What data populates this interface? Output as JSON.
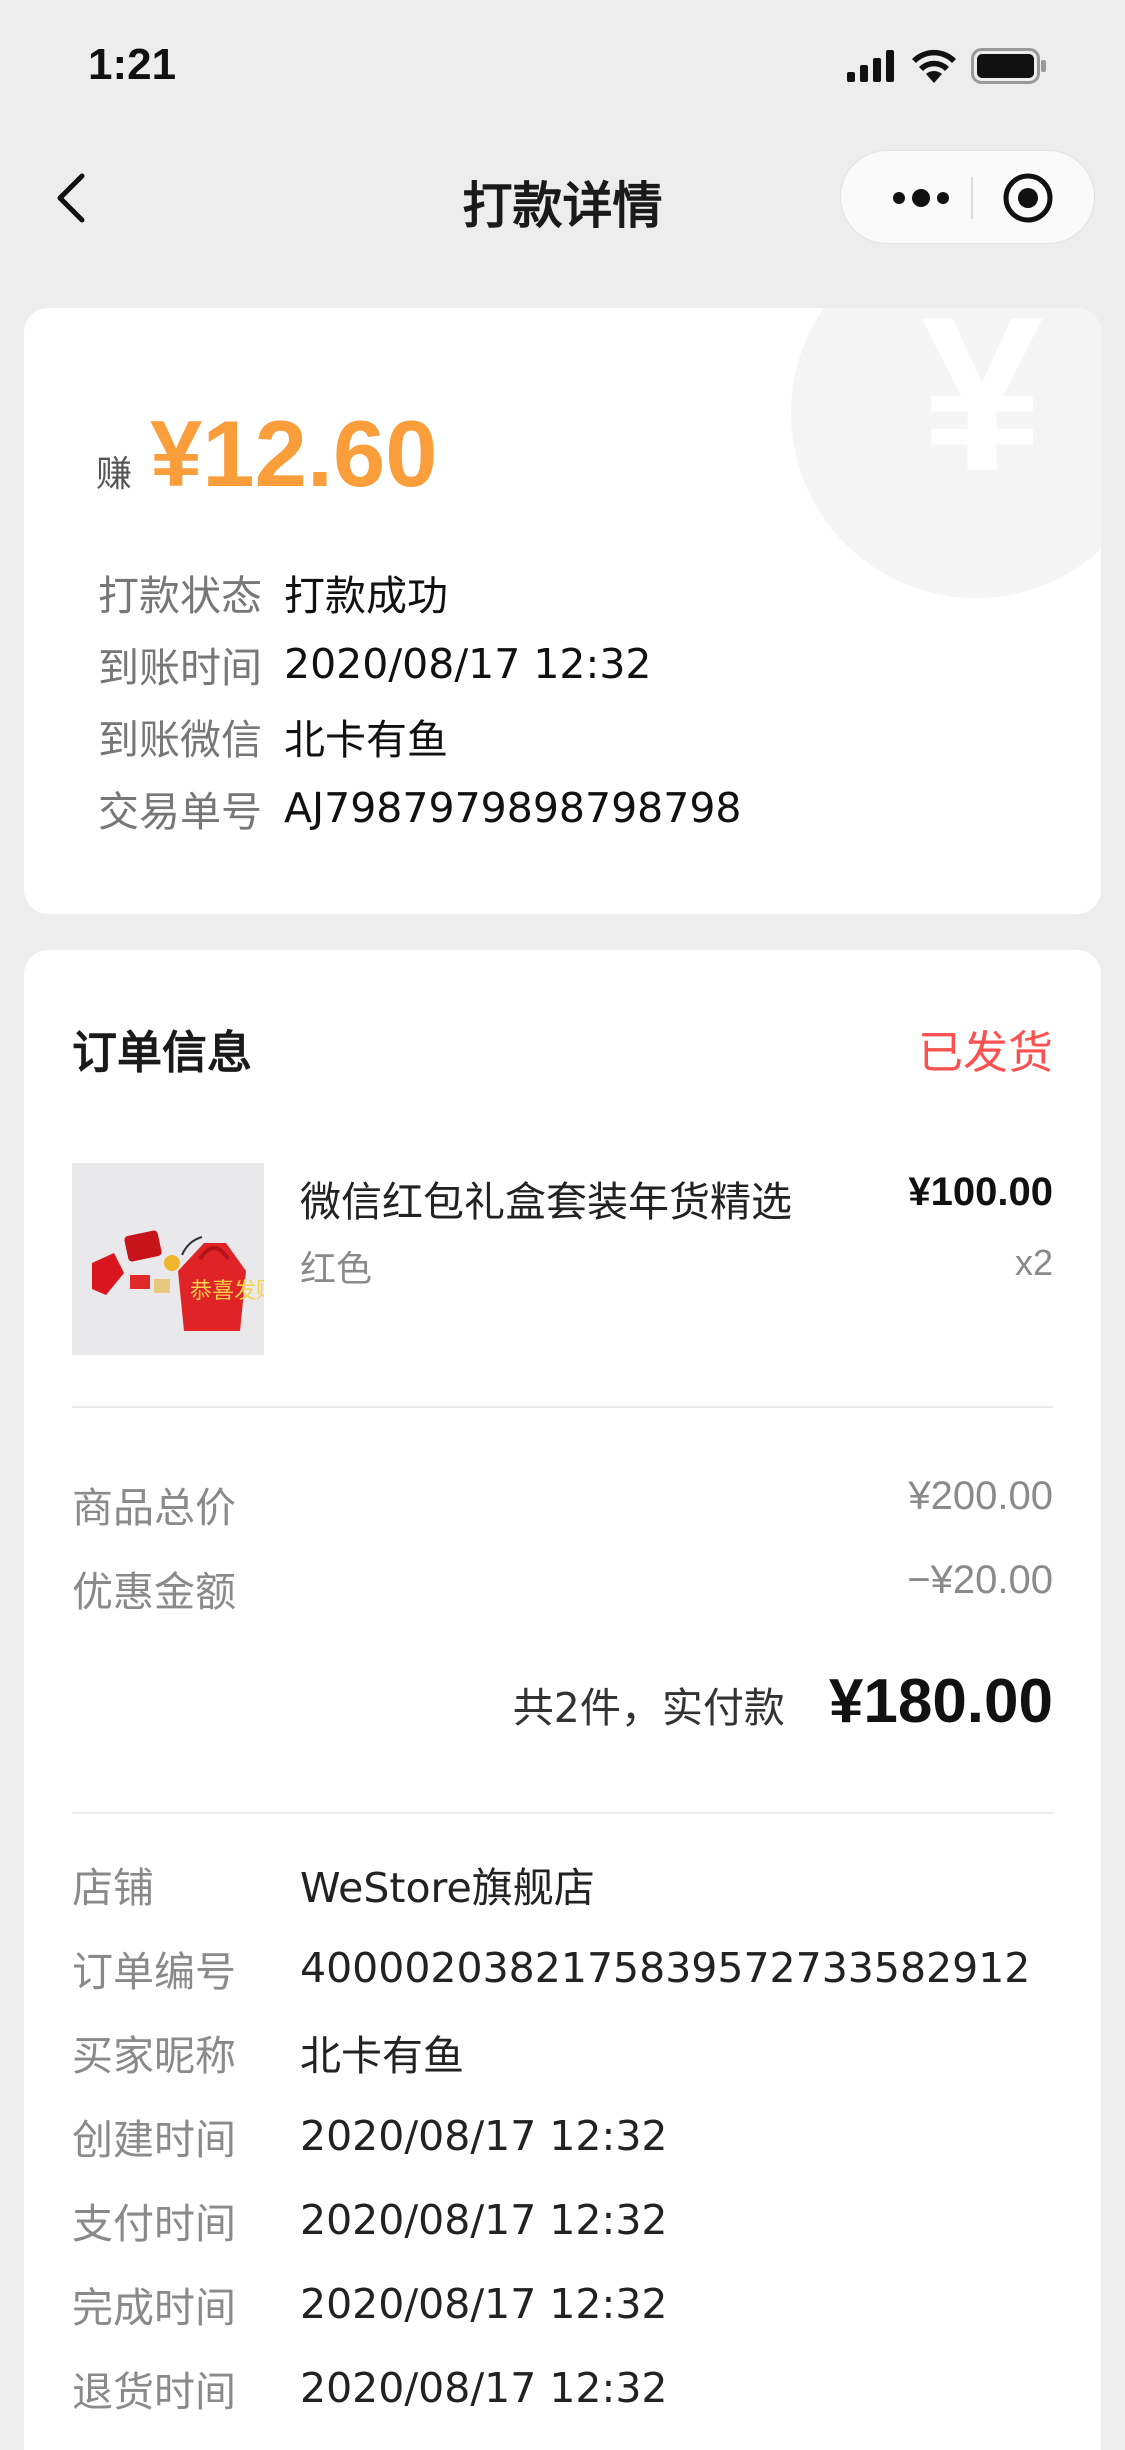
{
  "status_bar": {
    "time": "1:21"
  },
  "nav": {
    "title": "打款详情"
  },
  "payout": {
    "earn_label": "赚",
    "amount": "¥12.60",
    "yen_symbol": "¥",
    "rows": [
      {
        "label": "打款状态",
        "value": "打款成功"
      },
      {
        "label": "到账时间",
        "value": "2020/08/17 12:32"
      },
      {
        "label": "到账微信",
        "value": "北卡有鱼"
      },
      {
        "label": "交易单号",
        "value": "AJ7987979898798798"
      }
    ]
  },
  "order": {
    "heading": "订单信息",
    "status": "已发货",
    "product": {
      "name": "微信红包礼盒套装年货精选",
      "spec": "红色",
      "price": "¥100.00",
      "qty": "x2",
      "image_text": "恭喜发财"
    },
    "goods_total_label": "商品总价",
    "goods_total_value": "¥200.00",
    "discount_label": "优惠金额",
    "discount_value": "−¥20.00",
    "total_label": "共2件，实付款",
    "total_value": "¥180.00",
    "info": [
      {
        "label": "店铺",
        "value": "WeStore旗舰店"
      },
      {
        "label": "订单编号",
        "value": "4000020382175839572733582912"
      },
      {
        "label": "买家昵称",
        "value": "北卡有鱼"
      },
      {
        "label": "创建时间",
        "value": "2020/08/17 12:32"
      },
      {
        "label": "支付时间",
        "value": "2020/08/17 12:32"
      },
      {
        "label": "完成时间",
        "value": "2020/08/17 12:32"
      },
      {
        "label": "退货时间",
        "value": "2020/08/17 12:32"
      }
    ]
  },
  "colors": {
    "accent_orange": "#fa9d3b",
    "status_red": "#fa5151",
    "background": "#ededed"
  },
  "icons": [
    "signal-icon",
    "wifi-icon",
    "battery-icon",
    "back-arrow-icon",
    "more-dots-icon",
    "target-icon",
    "yen-icon"
  ]
}
